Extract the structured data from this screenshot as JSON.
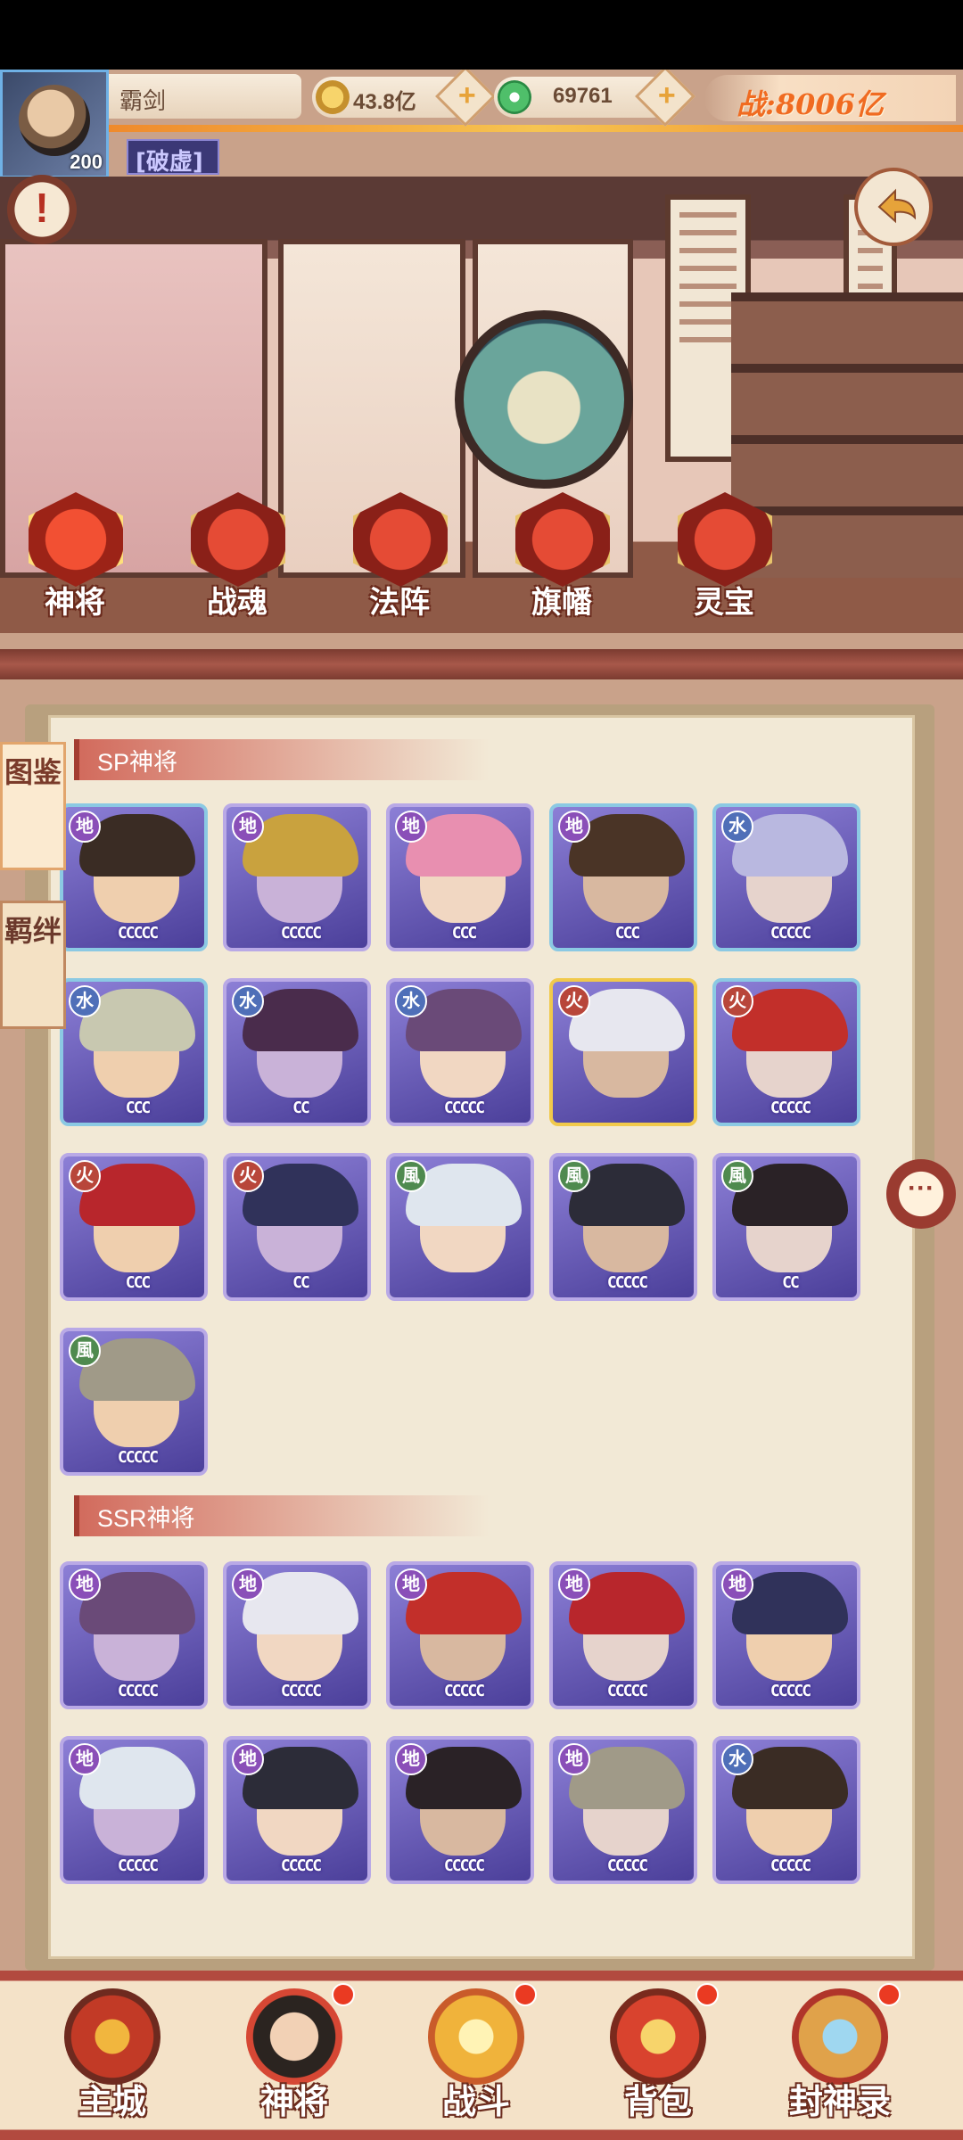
{
  "player": {
    "name": "霸剑",
    "level": "200",
    "title": "[破虚]"
  },
  "resources": {
    "gold": {
      "value": "43.8亿",
      "icon": "gold-coin-icon"
    },
    "jade": {
      "value": "69761",
      "icon": "jade-icon"
    },
    "plus": "+",
    "power": "战:8006亿"
  },
  "top_buttons": {
    "info": "!",
    "back_icon": "back-arrow-icon"
  },
  "categories": [
    {
      "label": "神将",
      "icon": "general-helmet-icon",
      "active": true
    },
    {
      "label": "战魂",
      "icon": "war-soul-mask-icon",
      "active": false
    },
    {
      "label": "法阵",
      "icon": "formation-scroll-icon",
      "active": false
    },
    {
      "label": "旗幡",
      "icon": "banner-flag-icon",
      "active": false
    },
    {
      "label": "灵宝",
      "icon": "treasure-gourd-icon",
      "active": false
    }
  ],
  "side_tabs": [
    {
      "label": "图鉴",
      "active": true
    },
    {
      "label": "羁绊",
      "active": false
    }
  ],
  "chat_button": "···",
  "sections": [
    {
      "title": "SP神将",
      "heroes": [
        {
          "element": "地",
          "stars": "CCCCC"
        },
        {
          "element": "地",
          "stars": "CCCCC"
        },
        {
          "element": "地",
          "stars": "CCC"
        },
        {
          "element": "地",
          "stars": "CCC"
        },
        {
          "element": "水",
          "stars": "CCCCC"
        },
        {
          "element": "水",
          "stars": "CCC"
        },
        {
          "element": "水",
          "stars": "CC"
        },
        {
          "element": "水",
          "stars": "CCCCC"
        },
        {
          "element": "火",
          "stars": ""
        },
        {
          "element": "火",
          "stars": "CCCCC"
        },
        {
          "element": "火",
          "stars": "CCC"
        },
        {
          "element": "火",
          "stars": "CC"
        },
        {
          "element": "風",
          "stars": ""
        },
        {
          "element": "風",
          "stars": "CCCCC"
        },
        {
          "element": "風",
          "stars": "CC"
        },
        {
          "element": "風",
          "stars": "CCCCC"
        }
      ]
    },
    {
      "title": "SSR神将",
      "heroes": [
        {
          "element": "地",
          "stars": "CCCCC"
        },
        {
          "element": "地",
          "stars": "CCCCC"
        },
        {
          "element": "地",
          "stars": "CCCCC"
        },
        {
          "element": "地",
          "stars": "CCCCC"
        },
        {
          "element": "地",
          "stars": "CCCCC"
        },
        {
          "element": "地",
          "stars": "CCCCC"
        },
        {
          "element": "地",
          "stars": "CCCCC"
        },
        {
          "element": "地",
          "stars": "CCCCC"
        },
        {
          "element": "地",
          "stars": "CCCCC"
        },
        {
          "element": "水",
          "stars": "CCCCC"
        }
      ]
    }
  ],
  "bottom_nav": [
    {
      "label": "主城",
      "icon": "main-city-icon",
      "badge": false
    },
    {
      "label": "神将",
      "icon": "generals-icon",
      "badge": true
    },
    {
      "label": "战斗",
      "icon": "crossed-swords-icon",
      "badge": true
    },
    {
      "label": "背包",
      "icon": "backpack-icon",
      "badge": true
    },
    {
      "label": "封神录",
      "icon": "deification-record-icon",
      "badge": true
    }
  ],
  "colors": {
    "earth": "#8a4fb8",
    "water": "#4f6fb8",
    "fire": "#b8463a",
    "wind": "#4f8a4f",
    "accent": "#f06b21",
    "frame": "#b24a3f"
  }
}
